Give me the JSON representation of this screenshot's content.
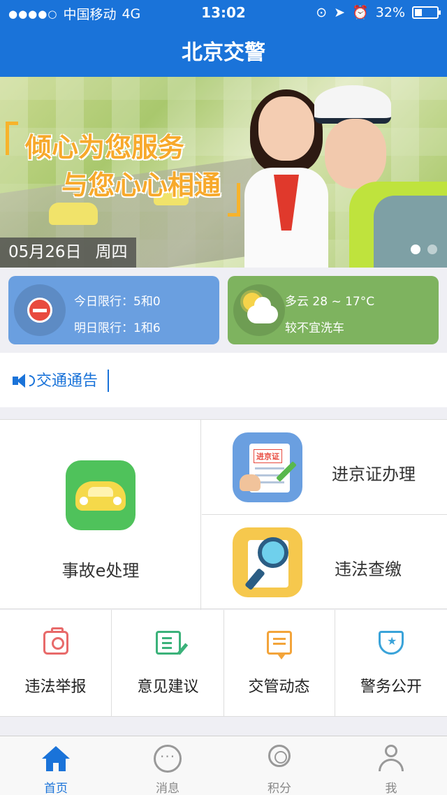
{
  "status_bar": {
    "signal": "●●●●○",
    "carrier": "中国移动",
    "network": "4G",
    "time": "13:02",
    "battery": "32%"
  },
  "header": {
    "title": "北京交警"
  },
  "banner": {
    "slogan_line1": "倾心为您服务",
    "slogan_line2": "与您心心相通",
    "date": "05月26日",
    "weekday": "周四",
    "slide_count": 2,
    "active_slide": 1
  },
  "traffic_limit": {
    "today": "今日限行：5和0",
    "tomorrow": "明日限行：1和6"
  },
  "weather": {
    "summary": "多云 28 ~ 17°C",
    "wash_advice": "较不宜洗车"
  },
  "notice": {
    "label": "交通通告"
  },
  "services_main": {
    "accident": "事故e处理",
    "permit": "进京证办理",
    "permit_badge": "进京证",
    "violation": "违法查缴"
  },
  "services_small": [
    {
      "label": "违法举报",
      "icon": "camera-icon"
    },
    {
      "label": "意见建议",
      "icon": "note-edit-icon"
    },
    {
      "label": "交管动态",
      "icon": "message-icon"
    },
    {
      "label": "警务公开",
      "icon": "shield-star-icon"
    }
  ],
  "tabbar": [
    {
      "label": "首页",
      "icon": "home-icon",
      "active": true
    },
    {
      "label": "消息",
      "icon": "chat-icon",
      "active": false
    },
    {
      "label": "积分",
      "icon": "medal-icon",
      "active": false
    },
    {
      "label": "我",
      "icon": "person-icon",
      "active": false
    }
  ],
  "colors": {
    "primary": "#1a73d9",
    "limit_card": "#6a9fe0",
    "weather_card": "#7eb35f",
    "slogan": "#f7a92b"
  }
}
